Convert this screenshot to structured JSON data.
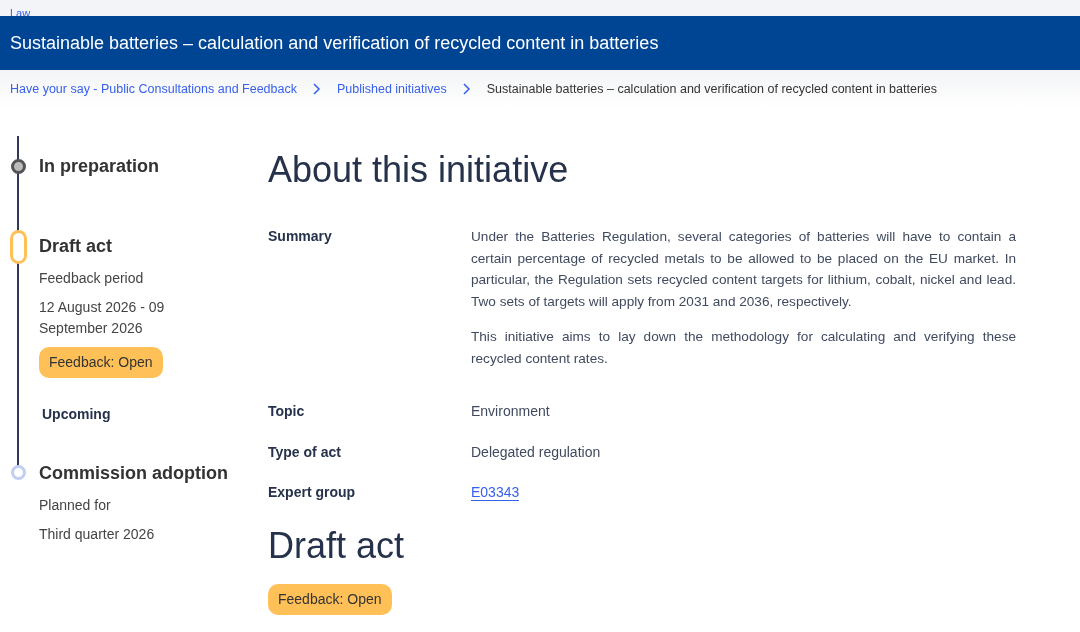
{
  "top_link": "Law",
  "page_title": "Sustainable batteries – calculation and verification of recycled content in batteries",
  "breadcrumb": [
    {
      "label": "Have your say - Public Consultations and Feedback",
      "link": true
    },
    {
      "label": "Published initiatives",
      "link": true
    },
    {
      "label": "Sustainable batteries – calculation and verification of recycled content in batteries",
      "link": false
    }
  ],
  "timeline": [
    {
      "kind": "done",
      "title": "In preparation"
    },
    {
      "kind": "current",
      "title": "Draft act",
      "lines": [
        "Feedback period",
        "12 August 2026 - 09 September 2026"
      ],
      "badge": "Feedback: Open"
    },
    {
      "kind": "heading",
      "title": "Upcoming"
    },
    {
      "kind": "upcoming",
      "title": "Commission adoption",
      "lines": [
        "Planned for",
        "Third quarter 2026"
      ]
    }
  ],
  "about": {
    "heading": "About this initiative",
    "fields": [
      {
        "label": "Summary",
        "paragraphs": [
          "Under the Batteries Regulation, several categories of batteries will have to contain a certain percentage of recycled metals to be allowed to be placed on the EU market. In particular, the Regulation sets recycled content targets for lithium, cobalt, nickel and lead. Two sets of targets will apply from 2031 and 2036, respectively.",
          "This initiative aims to lay down the methodology for calculating and verifying these recycled content rates."
        ]
      },
      {
        "label": "Topic",
        "value": "Environment"
      },
      {
        "label": "Type of act",
        "value": "Delegated regulation"
      },
      {
        "label": "Expert group",
        "link": "E03343"
      }
    ]
  },
  "draft_act": {
    "heading": "Draft act",
    "badge": "Feedback: Open"
  }
}
